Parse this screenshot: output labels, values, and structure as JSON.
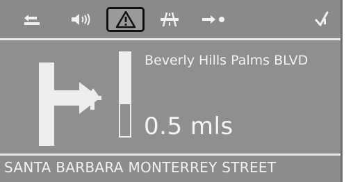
{
  "toolbar": {
    "items": [
      {
        "icon": "route-back-icon",
        "active": false
      },
      {
        "icon": "volume-icon",
        "active": false
      },
      {
        "icon": "warning-icon",
        "active": true
      },
      {
        "icon": "highway-icon",
        "active": false
      },
      {
        "icon": "destination-icon",
        "active": false
      },
      {
        "icon": "checkmark-icon",
        "active": false
      }
    ]
  },
  "guidance": {
    "next_street": "Beverly Hills Palms BLVD",
    "distance": "0.5 mls",
    "progress": 0.62
  },
  "current_street": "SANTA BARBARA MONTERREY STREET",
  "colors": {
    "background": "#8e8e8e",
    "foreground": "#f2f2f2",
    "active_border": "#111111"
  }
}
